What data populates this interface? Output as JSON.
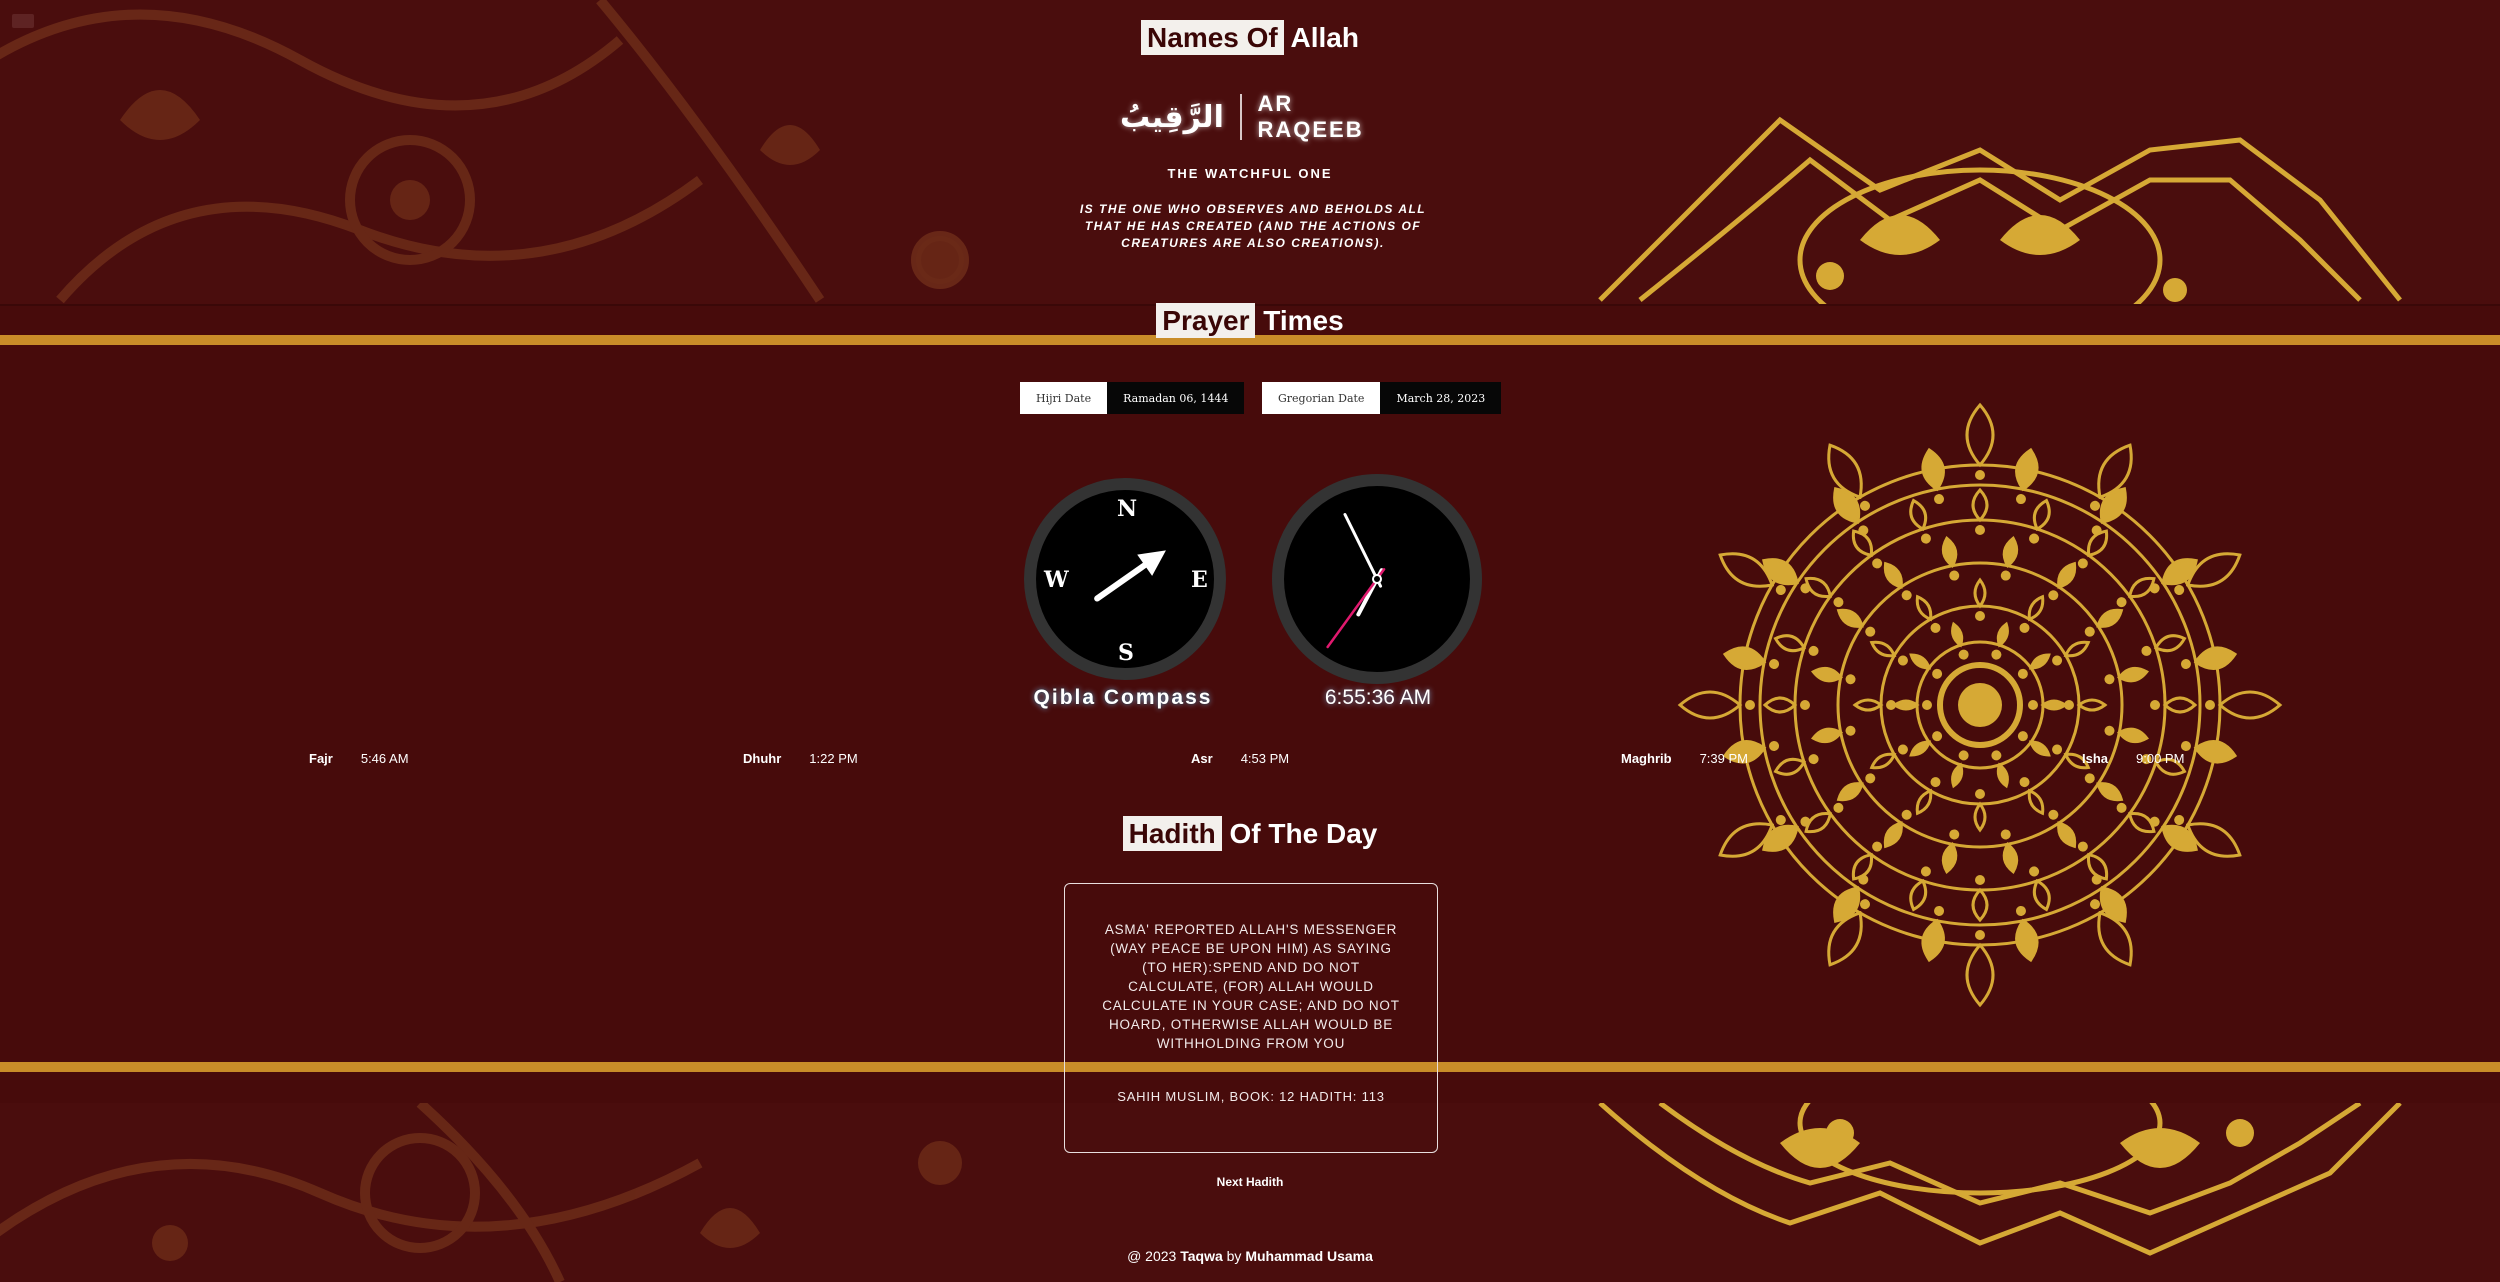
{
  "names_section": {
    "heading_highlight": "Names Of",
    "heading_rest": "Allah",
    "arabic_name": "الرَّقِيبُ",
    "transliteration": "AR RAQEEB",
    "meaning": "THE WATCHFUL ONE",
    "explanation": "IS THE ONE WHO OBSERVES AND BEHOLDS ALL THAT HE HAS CREATED (AND THE ACTIONS OF CREATURES ARE ALSO CREATIONS)."
  },
  "prayer_section": {
    "heading_highlight": "Prayer",
    "heading_rest": "Times",
    "hijri": {
      "label": "Hijri Date",
      "value": "Ramadan 06, 1444"
    },
    "gregorian": {
      "label": "Gregorian Date",
      "value": "March 28, 2023"
    },
    "compass": {
      "label": "Qibla Compass",
      "north": "N",
      "east": "E",
      "south": "S",
      "west": "W",
      "qibla_bearing_deg": 55
    },
    "clock": {
      "time_text": "6:55:36 AM",
      "hour": 6,
      "minute": 55,
      "second": 36,
      "second_hand_color": "#e0196e"
    },
    "prayers": [
      {
        "name": "Fajr",
        "time": "5:46 AM"
      },
      {
        "name": "Dhuhr",
        "time": "1:22 PM"
      },
      {
        "name": "Asr",
        "time": "4:53 PM"
      },
      {
        "name": "Maghrib",
        "time": "7:39 PM"
      },
      {
        "name": "Isha",
        "time": "9:00 PM"
      }
    ]
  },
  "hadith_section": {
    "heading_highlight": "Hadith",
    "heading_rest": "Of The Day",
    "text": "ASMA' REPORTED ALLAH'S MESSENGER (WAY PEACE BE UPON HIM) AS SAYING (TO HER):SPEND AND DO NOT CALCULATE, (FOR) ALLAH WOULD CALCULATE IN YOUR CASE; AND DO NOT HOARD, OTHERWISE ALLAH WOULD BE WITHHOLDING FROM YOU",
    "reference": "SAHIH MUSLIM, BOOK: 12 HADITH: 113",
    "next_label": "Next Hadith"
  },
  "footer": {
    "prefix": "@ 2023",
    "brand": "Taqwa",
    "by": "by",
    "author": "Muhammad Usama"
  },
  "colors": {
    "background": "#470b0b",
    "gold": "#c98d29",
    "ornament_gold": "#d6a935",
    "heading_highlight_bg": "#f3f0ec"
  }
}
